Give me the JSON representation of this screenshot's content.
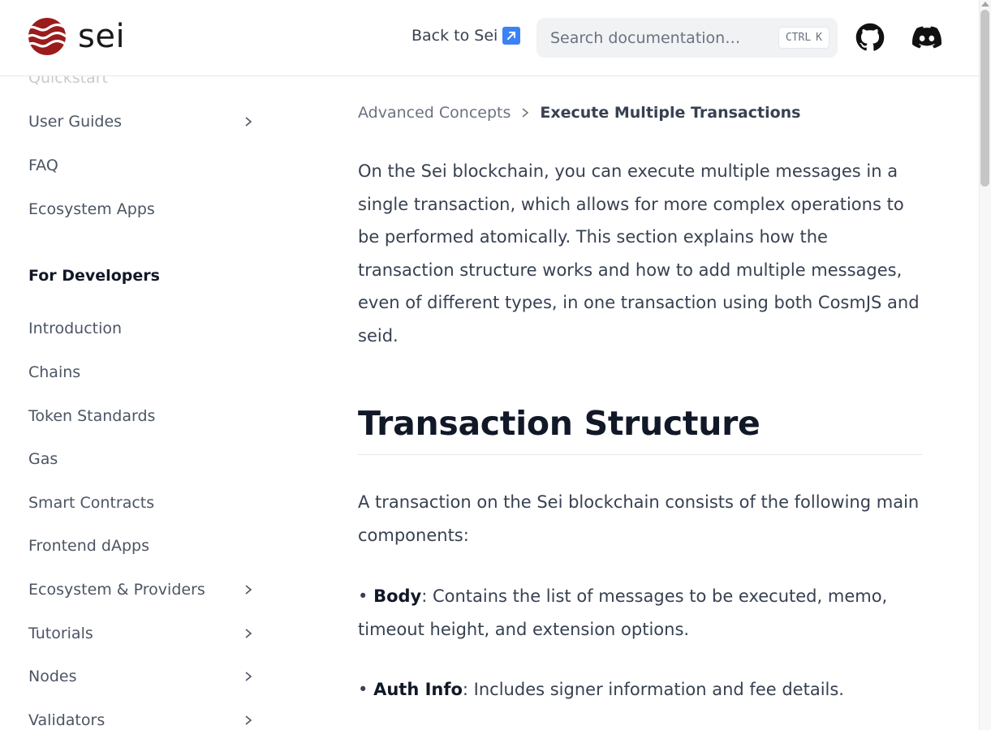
{
  "header": {
    "logo_text": "sei",
    "back_link": "Back to Sei",
    "search_placeholder": "Search documentation…",
    "search_shortcut_ctrl": "CTRL",
    "search_shortcut_key": "K"
  },
  "sidebar": {
    "items_top": [
      {
        "label": "Quickstart"
      },
      {
        "label": "User Guides"
      },
      {
        "label": "FAQ"
      },
      {
        "label": "Ecosystem Apps"
      }
    ],
    "section_heading": "For Developers",
    "items_dev": [
      {
        "label": "Introduction"
      },
      {
        "label": "Chains"
      },
      {
        "label": "Token Standards"
      },
      {
        "label": "Gas"
      },
      {
        "label": "Smart Contracts"
      },
      {
        "label": "Frontend dApps"
      },
      {
        "label": "Ecosystem & Providers"
      },
      {
        "label": "Tutorials"
      },
      {
        "label": "Nodes"
      },
      {
        "label": "Validators"
      }
    ]
  },
  "breadcrumb": {
    "parent": "Advanced Concepts",
    "current": "Execute Multiple Transactions"
  },
  "content": {
    "intro": "On the Sei blockchain, you can execute multiple messages in a single transaction, which allows for more complex operations to be performed atomically. This section explains how the transaction structure works and how to add multiple messages, even of different types, in one transaction using both CosmJS and seid.",
    "heading": "Transaction Structure",
    "lead": "A transaction on the Sei blockchain consists of the following main components:",
    "bullets": [
      {
        "marker": "•",
        "term": "Body",
        "text": ": Contains the list of messages to be executed, memo, timeout height, and extension options."
      },
      {
        "marker": "•",
        "term": "Auth Info",
        "text": ": Includes signer information and fee details."
      }
    ]
  },
  "colors": {
    "brand_red": "#9b1c1c",
    "accent_blue": "#3b82f6"
  }
}
